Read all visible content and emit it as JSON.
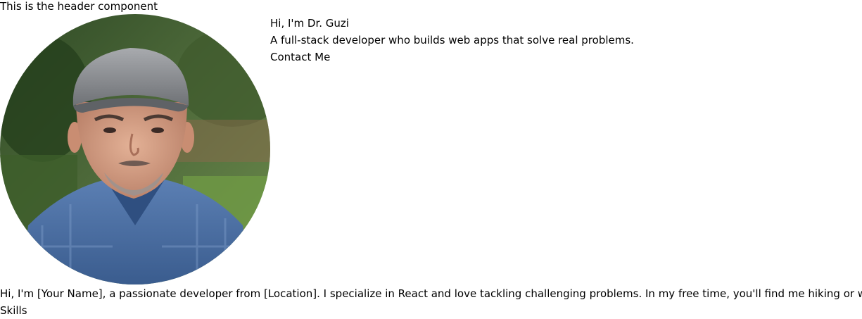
{
  "header": {
    "note": "This is the header component"
  },
  "hero": {
    "greeting": "Hi, I'm Dr. Guzi",
    "tagline": "A full-stack developer who builds web apps that solve real problems.",
    "contact_label": "Contact Me"
  },
  "about": {
    "text": "Hi, I'm [Your Name], a passionate developer from [Location]. I specialize in React and love tackling challenging problems. In my free time, you'll find me hiking or working on s"
  },
  "skills": {
    "heading": "Skills"
  }
}
